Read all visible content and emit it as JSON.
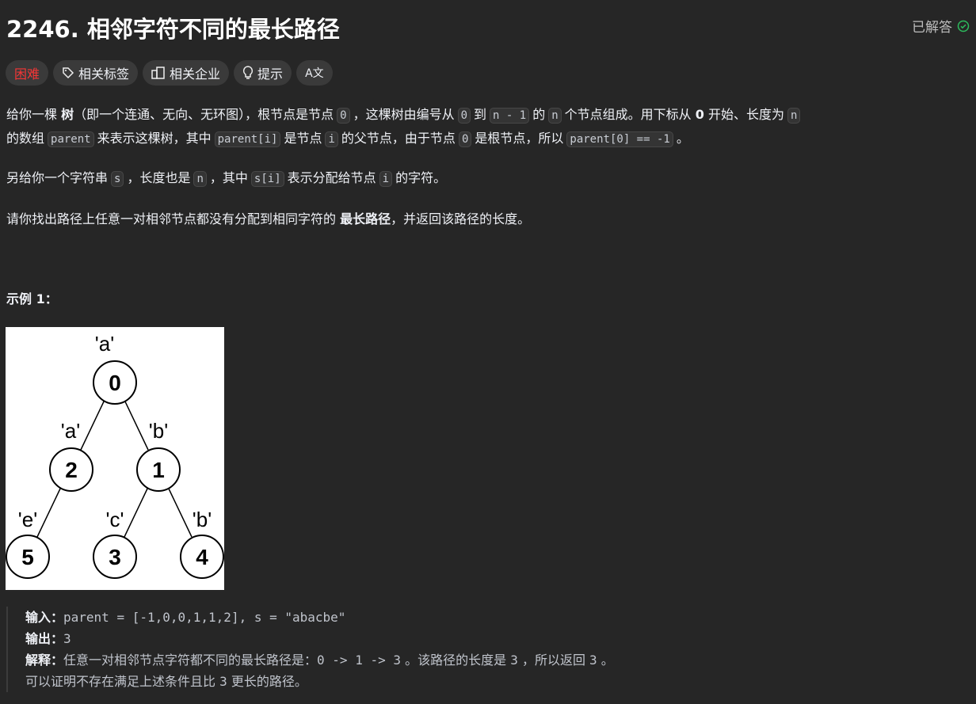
{
  "title": "2246. 相邻字符不同的最长路径",
  "status": "已解答",
  "tags": {
    "difficulty": "困难",
    "related_tags": "相关标签",
    "companies": "相关企业",
    "hint": "提示",
    "translate": "A文"
  },
  "desc": {
    "l1": [
      "给你一棵 ",
      "树",
      "（即一个连通、无向、无环图），根节点是节点",
      "0",
      "，这棵树由编号从",
      "0",
      "到",
      "n - 1",
      "的",
      "n",
      "个节点组成。用下标从 ",
      "0",
      " 开始、长度为",
      "n"
    ],
    "l2": [
      "的数组",
      "parent",
      "来表示这棵树，其中",
      "parent[i]",
      "是节点",
      "i",
      "的父节点，由于节点",
      "0",
      "是根节点，所以",
      "parent[0] == -1",
      "。"
    ],
    "l3": [
      "另给你一个字符串",
      "s",
      "，长度也是",
      "n",
      "，其中",
      "s[i]",
      "表示分配给节点",
      "i",
      "的字符。"
    ],
    "l4": [
      "请你找出路径上任意一对相邻节点都没有分配到相同字符的 ",
      "最长路径",
      "，并返回该路径的长度。"
    ]
  },
  "example_title": "示例 1：",
  "tree": {
    "nodes": [
      {
        "id": "0",
        "ch": "'a'"
      },
      {
        "id": "2",
        "ch": "'a'"
      },
      {
        "id": "1",
        "ch": "'b'"
      },
      {
        "id": "5",
        "ch": "'e'"
      },
      {
        "id": "3",
        "ch": "'c'"
      },
      {
        "id": "4",
        "ch": "'b'"
      }
    ]
  },
  "example": {
    "input_label": "输入：",
    "input": "parent = [-1,0,0,1,1,2], s = \"abacbe\"",
    "output_label": "输出：",
    "output": "3",
    "explain_label": "解释：",
    "explain1": "任意一对相邻节点字符都不同的最长路径是：",
    "path": "0 -> 1 -> 3",
    "explain2": "。该路径的长度是",
    "len": "3",
    "explain3": "，所以返回",
    "ret": "3",
    "explain4": "。",
    "note1": "可以证明不存在满足上述条件且比",
    "note_num": "3",
    "note2": "更长的路径。"
  }
}
